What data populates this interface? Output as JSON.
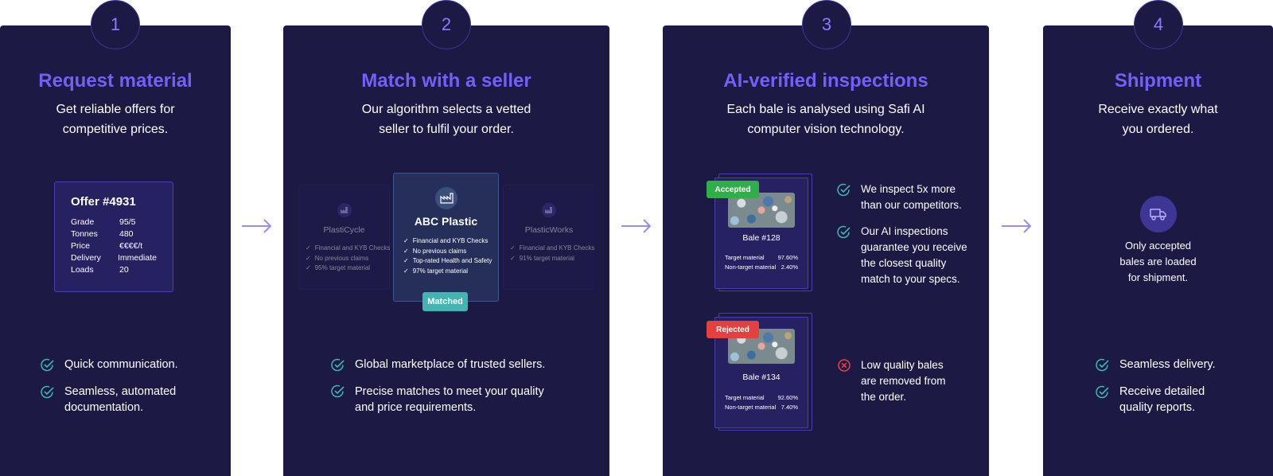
{
  "colors": {
    "panel": "#1c1a44",
    "title": "#7460f6",
    "teal": "#3fb6b2",
    "accepted": "#2fae4a",
    "rejected": "#e54040"
  },
  "steps": [
    {
      "number": "1",
      "title": "Request material",
      "subtitle": [
        "Get reliable offers for",
        "competitive prices."
      ],
      "offer": {
        "title": "Offer #4931",
        "rows": [
          {
            "key": "Grade",
            "value": "95/5"
          },
          {
            "key": "Tonnes",
            "value": "480"
          },
          {
            "key": "Price",
            "value": "€€€€/t"
          },
          {
            "key": "Delivery",
            "value": "Immediate"
          },
          {
            "key": "Loads",
            "value": "20"
          }
        ]
      },
      "features": [
        {
          "lines": [
            "Quick communication."
          ]
        },
        {
          "lines": [
            "Seamless, automated",
            "documentation."
          ]
        }
      ]
    },
    {
      "number": "2",
      "title": "Match with a seller",
      "subtitle": [
        "Our algorithm selects a vetted",
        "seller to fulfil your order."
      ],
      "sellers": [
        {
          "name": "PlastiCycle",
          "items": [
            "Financial and KYB Checks",
            "No previous claims",
            "95% target material"
          ]
        },
        {
          "name": "ABC Plastic",
          "items": [
            "Financial and KYB Checks",
            "No previous claims",
            "Top-rated Health and Safety",
            "97% target material"
          ]
        },
        {
          "name": "PlasticWorks",
          "items": [
            "Financial and KYB Checks",
            "91% target material"
          ]
        }
      ],
      "matched_label": "Matched",
      "features": [
        {
          "lines": [
            "Global marketplace of trusted sellers."
          ]
        },
        {
          "lines": [
            "Precise matches to meet your quality",
            "and price requirements."
          ]
        }
      ]
    },
    {
      "number": "3",
      "title": "AI-verified inspections",
      "subtitle": [
        "Each bale is analysed using Safi AI",
        "computer vision technology."
      ],
      "bales": [
        {
          "tag": "Accepted",
          "name": "Bale #128",
          "target_label": "Target material",
          "target": "97.60%",
          "non_target_label": "Non-target material",
          "non_target": "2.40%"
        },
        {
          "tag": "Rejected",
          "name": "Bale #134",
          "target_label": "Target material",
          "target": "92.60%",
          "non_target_label": "Non-target material",
          "non_target": "7.40%"
        }
      ],
      "features": [
        {
          "lines": [
            "We inspect 5x more",
            "than our competitors."
          ]
        },
        {
          "lines": [
            "Our AI inspections",
            "guarantee you receive",
            "the closest quality",
            "match to your specs."
          ]
        },
        {
          "lines": [
            "Low quality bales",
            "are removed from",
            "the order."
          ]
        }
      ]
    },
    {
      "number": "4",
      "title": "Shipment",
      "subtitle": [
        "Receive exactly what",
        "you ordered."
      ],
      "icon": "truck-icon",
      "note": [
        "Only accepted",
        "bales are loaded",
        "for shipment."
      ],
      "features": [
        {
          "lines": [
            "Seamless delivery."
          ]
        },
        {
          "lines": [
            "Receive detailed",
            "quality reports."
          ]
        }
      ]
    }
  ]
}
